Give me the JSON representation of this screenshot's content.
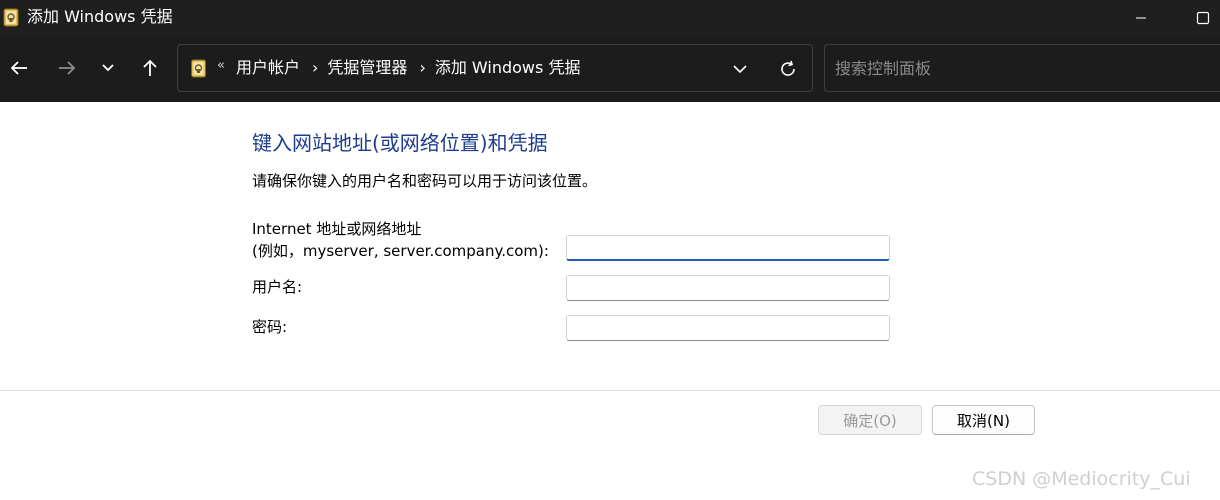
{
  "window": {
    "title": "添加 Windows 凭据"
  },
  "nav": {
    "breadcrumb_overflow": "«",
    "breadcrumbs": [
      "用户帐户",
      "凭据管理器",
      "添加 Windows 凭据"
    ],
    "breadcrumb_separator": "›",
    "search_placeholder": "搜索控制面板"
  },
  "content": {
    "heading": "键入网站地址(或网络位置)和凭据",
    "subtext": "请确保你键入的用户名和密码可以用于访问该位置。",
    "address_label_line1": "Internet 地址或网络地址",
    "address_label_line2": "(例如，myserver, server.company.com):",
    "address_value": "",
    "username_label": "用户名:",
    "username_value": "",
    "password_label": "密码:",
    "password_value": ""
  },
  "buttons": {
    "ok_label": "确定(O)",
    "cancel_label": "取消(N)"
  },
  "watermark": "CSDN @Mediocrity_Cui",
  "colors": {
    "titlebar_bg": "#1f1f1f",
    "heading": "#1e3d8f",
    "focus_accent": "#1b5fb1"
  }
}
